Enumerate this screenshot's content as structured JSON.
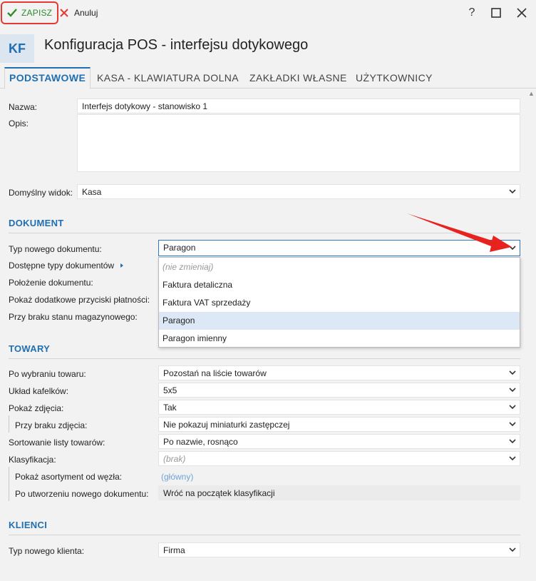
{
  "toolbar": {
    "save_label": "ZAPISZ",
    "cancel_label": "Anuluj",
    "help_label": "?"
  },
  "header": {
    "badge": "KF",
    "title": "Konfiguracja POS - interfejsu dotykowego"
  },
  "tabs": [
    {
      "label": "PODSTAWOWE"
    },
    {
      "label": "KASA - KLAWIATURA DOLNA"
    },
    {
      "label": "ZAKŁADKI WŁASNE"
    },
    {
      "label": "UŻYTKOWNICY"
    }
  ],
  "general": {
    "name_label": "Nazwa:",
    "name_value": "Interfejs dotykowy - stanowisko 1",
    "desc_label": "Opis:",
    "view_label": "Domyślny widok:",
    "view_value": "Kasa"
  },
  "document": {
    "title": "DOKUMENT",
    "type_label": "Typ nowego dokumentu:",
    "type_value": "Paragon",
    "available_label": "Dostępne typy dokumentów",
    "position_label": "Położenie dokumentu:",
    "extra_buttons_label": "Pokaż dodatkowe przyciski płatności:",
    "no_stock_label": "Przy braku stanu magazynowego:"
  },
  "dropdown": {
    "options": [
      {
        "label": "(nie zmieniaj)"
      },
      {
        "label": "Faktura detaliczna"
      },
      {
        "label": "Faktura VAT sprzedaży"
      },
      {
        "label": "Paragon"
      },
      {
        "label": "Paragon imienny"
      }
    ],
    "selected": "Paragon"
  },
  "products": {
    "title": "TOWARY",
    "after_select_label": "Po wybraniu towaru:",
    "after_select_value": "Pozostań na liście towarów",
    "tile_layout_label": "Układ kafelków:",
    "tile_layout_value": "5x5",
    "show_image_label": "Pokaż zdjęcia:",
    "show_image_value": "Tak",
    "no_image_label": "Przy braku zdjęcia:",
    "no_image_value": "Nie pokazuj miniaturki zastępczej",
    "sort_label": "Sortowanie listy towarów:",
    "sort_value": "Po nazwie, rosnąco",
    "class_label": "Klasyfikacja:",
    "class_value": "(brak)",
    "node_label": "Pokaż asortyment od węzła:",
    "node_value": "(główny)",
    "after_new_label": "Po utworzeniu nowego dokumentu:",
    "after_new_value": "Wróć na początek klasyfikacji"
  },
  "clients": {
    "title": "KLIENCI",
    "type_label": "Typ nowego klienta:",
    "type_value": "Firma"
  },
  "colors": {
    "accent": "#1f6fb2",
    "save_green": "#2e8b2e",
    "highlight_red": "#e53935",
    "selected_row": "#dce8f5"
  },
  "icons": {
    "save": "check-icon",
    "cancel": "close-x-icon",
    "maximize": "maximize-icon",
    "close": "close-icon",
    "chevron": "chevron-down-icon",
    "expand": "triangle-right-icon"
  }
}
